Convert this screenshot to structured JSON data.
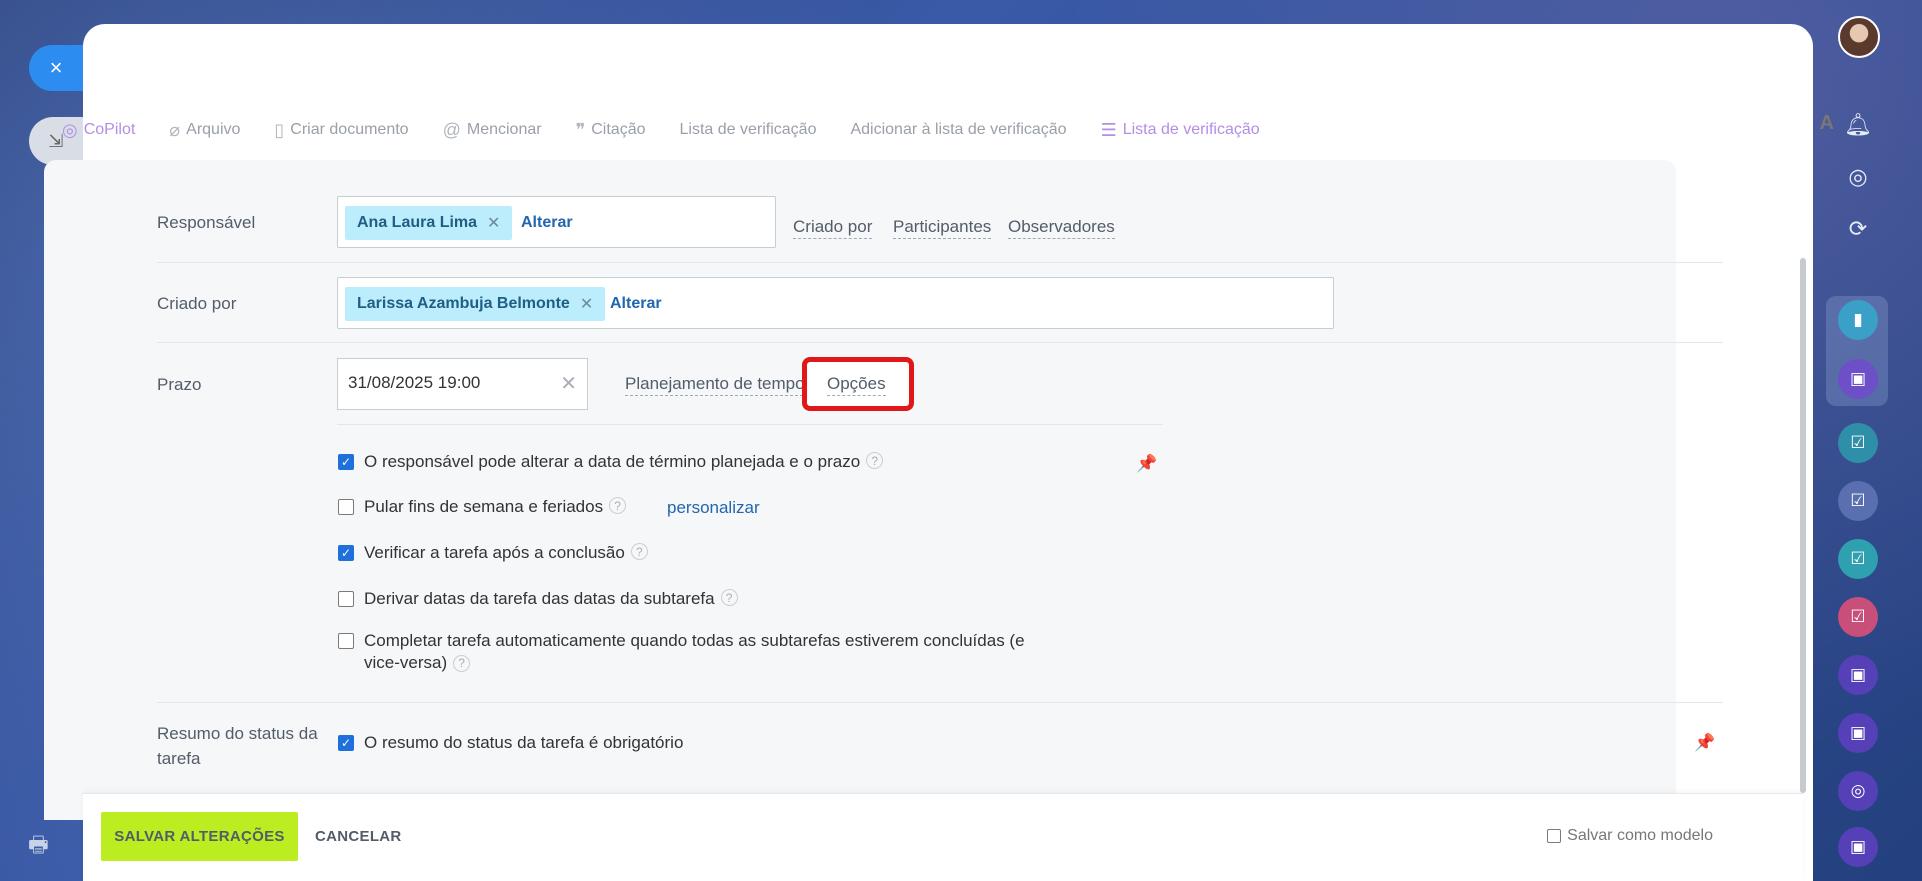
{
  "left": {
    "close_icon": "×",
    "collapse_icon": "⇲",
    "print_icon": "🖶"
  },
  "toolbar": {
    "copilot": "CoPilot",
    "file": "Arquivo",
    "create_doc": "Criar documento",
    "mention": "Mencionar",
    "quote": "Citação",
    "checklist": "Lista de verificação",
    "add_to_checklist": "Adicionar à lista de verificação",
    "checklist2": "Lista de verificação",
    "font": "A"
  },
  "form": {
    "responsible": {
      "label": "Responsável",
      "person": "Ana Laura Lima",
      "change": "Alterar",
      "links": [
        "Criado por",
        "Participantes",
        "Observadores"
      ]
    },
    "created_by": {
      "label": "Criado por",
      "person": "Larissa Azambuja Belmonte",
      "change": "Alterar"
    },
    "deadline": {
      "label": "Prazo",
      "value": "31/08/2025 19:00",
      "planning": "Planejamento de tempo",
      "options": "Opções"
    },
    "options": [
      {
        "text": "O responsável pode alterar a data de término planejada e o prazo",
        "checked": true
      },
      {
        "text": "Pular fins de semana e feriados",
        "checked": false,
        "link": "personalizar"
      },
      {
        "text": "Verificar a tarefa após a conclusão",
        "checked": true
      },
      {
        "text": "Derivar datas da tarefa das datas da subtarefa",
        "checked": false
      },
      {
        "text": "Completar tarefa automaticamente quando todas as subtarefas estiverem concluídas (e vice-versa)",
        "checked": false
      }
    ],
    "status_summary": {
      "label": "Resumo do status da tarefa",
      "option": "O resumo do status da tarefa é obrigatório",
      "checked": true
    }
  },
  "footer": {
    "save": "SALVAR ALTERAÇÕES",
    "cancel": "CANCELAR",
    "template": "Salvar como modelo"
  },
  "colors": {
    "accent": "#2066b0",
    "save": "#bbed21",
    "highlight": "#e01818",
    "copilot": "#b38ee6"
  }
}
